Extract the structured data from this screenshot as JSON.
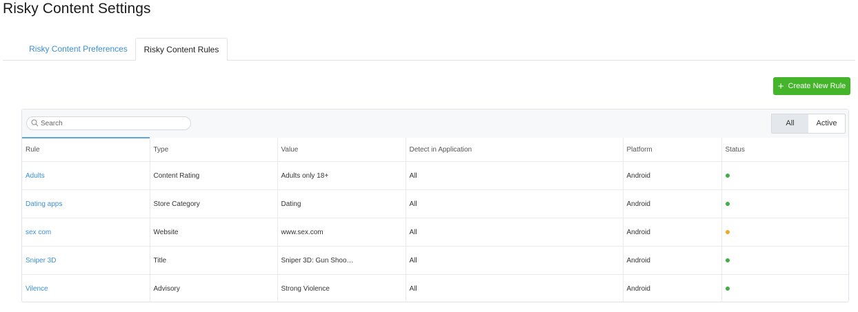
{
  "page": {
    "title": "Risky Content Settings"
  },
  "tabs": [
    {
      "label": "Risky Content Preferences",
      "active": false
    },
    {
      "label": "Risky Content Rules",
      "active": true
    }
  ],
  "toolbar": {
    "create_label": "Create New Rule",
    "create_icon": "plus-icon"
  },
  "search": {
    "placeholder": "Search",
    "value": ""
  },
  "filter": {
    "options": [
      "All",
      "Active"
    ],
    "selected": "All"
  },
  "table": {
    "columns": [
      "Rule",
      "Type",
      "Value",
      "Detect in Application",
      "Platform",
      "Status"
    ],
    "rows": [
      {
        "rule": "Adults",
        "type": "Content Rating",
        "value": "Adults only 18+",
        "detect": "All",
        "platform": "Android",
        "status_color": "#3cb043"
      },
      {
        "rule": "Dating apps",
        "type": "Store Category",
        "value": "Dating",
        "detect": "All",
        "platform": "Android",
        "status_color": "#3cb043"
      },
      {
        "rule": "sex com",
        "type": "Website",
        "value": "www.sex.com",
        "detect": "All",
        "platform": "Android",
        "status_color": "#f0a722"
      },
      {
        "rule": "Sniper 3D",
        "type": "Title",
        "value": "Sniper 3D: Gun Shoo…",
        "detect": "All",
        "platform": "Android",
        "status_color": "#3cb043"
      },
      {
        "rule": "Vilence",
        "type": "Advisory",
        "value": "Strong Violence",
        "detect": "All",
        "platform": "Android",
        "status_color": "#3cb043"
      }
    ]
  },
  "colors": {
    "accent": "#3b8fd6",
    "primary_button": "#44b52b"
  }
}
